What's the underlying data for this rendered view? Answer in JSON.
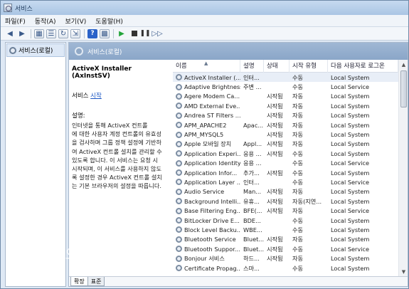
{
  "window": {
    "title": "서비스"
  },
  "menu": [
    "파일(F)",
    "동작(A)",
    "보기(V)",
    "도움말(H)"
  ],
  "toolbar": {
    "icons": [
      "back-icon",
      "forward-icon",
      "console-tree-icon",
      "list-icon",
      "refresh-icon",
      "export-icon",
      "help-icon",
      "properties-icon",
      "start-icon",
      "stop-icon",
      "pause-icon",
      "restart-icon"
    ]
  },
  "tree": {
    "root_label": "서비스(로컬)"
  },
  "header": {
    "title": "서비스(로컬)"
  },
  "details": {
    "service_name": "ActiveX Installer (AxInstSV)",
    "action_prefix": "서비스 ",
    "action_link": "시작",
    "desc_label": "설명:",
    "desc_lines": [
      "인터넷을 통해 ActiveX 컨트롤",
      "에 대한 사용자 계정 컨트롤의 유효성",
      "을 검사하며 그룹 정책 설정에 기반하",
      "여 ActiveX 컨트롤 설치를 관리할 수",
      "있도록 합니다. 이 서비스는 요청 시",
      "시작되며, 이 서비스를 사용하지 않도",
      "록 설정한 경우 ActiveX 컨트롤 설치",
      "는 기본 브라우저의 설정을 따릅니다."
    ]
  },
  "columns": {
    "name": "이름",
    "desc": "설명",
    "status": "상태",
    "startup": "시작 유형",
    "logon": "다음 사용자로 로그온"
  },
  "services": [
    {
      "name": "ActiveX Installer (...",
      "desc": "인터...",
      "status": "",
      "startup": "수동",
      "logon": "Local System"
    },
    {
      "name": "Adaptive Brightness",
      "desc": "주변 ...",
      "status": "",
      "startup": "수동",
      "logon": "Local Service"
    },
    {
      "name": "Agere Modem Ca...",
      "desc": "",
      "status": "시작됨",
      "startup": "자동",
      "logon": "Local System"
    },
    {
      "name": "AMD External Eve...",
      "desc": "",
      "status": "시작됨",
      "startup": "자동",
      "logon": "Local System"
    },
    {
      "name": "Andrea ST Filters ...",
      "desc": "",
      "status": "시작됨",
      "startup": "자동",
      "logon": "Local System"
    },
    {
      "name": "APM_APACHE2",
      "desc": "Apac...",
      "status": "시작됨",
      "startup": "자동",
      "logon": "Local System"
    },
    {
      "name": "APM_MYSQL5",
      "desc": "",
      "status": "시작됨",
      "startup": "자동",
      "logon": "Local System"
    },
    {
      "name": "Apple 모바일 장치",
      "desc": "Appl...",
      "status": "시작됨",
      "startup": "자동",
      "logon": "Local System"
    },
    {
      "name": "Application Experi...",
      "desc": "응용 ...",
      "status": "시작됨",
      "startup": "수동",
      "logon": "Local System"
    },
    {
      "name": "Application Identity",
      "desc": "응용 ...",
      "status": "",
      "startup": "수동",
      "logon": "Local Service"
    },
    {
      "name": "Application Infor...",
      "desc": "추가...",
      "status": "시작됨",
      "startup": "수동",
      "logon": "Local System"
    },
    {
      "name": "Application Layer ...",
      "desc": "인터...",
      "status": "",
      "startup": "수동",
      "logon": "Local Service"
    },
    {
      "name": "Audio Service",
      "desc": "Man...",
      "status": "시작됨",
      "startup": "자동",
      "logon": "Local System"
    },
    {
      "name": "Background Intelli...",
      "desc": "유휴...",
      "status": "시작됨",
      "startup": "자동(지연...",
      "logon": "Local System"
    },
    {
      "name": "Base Filtering Eng...",
      "desc": "BFE(...",
      "status": "시작됨",
      "startup": "자동",
      "logon": "Local Service"
    },
    {
      "name": "BitLocker Drive E...",
      "desc": "BDE...",
      "status": "",
      "startup": "수동",
      "logon": "Local System"
    },
    {
      "name": "Block Level Backu...",
      "desc": "WBE...",
      "status": "",
      "startup": "수동",
      "logon": "Local System"
    },
    {
      "name": "Bluetooth Service",
      "desc": "Bluet...",
      "status": "시작됨",
      "startup": "자동",
      "logon": "Local System"
    },
    {
      "name": "Bluetooth Suppor...",
      "desc": "Bluet...",
      "status": "시작됨",
      "startup": "수동",
      "logon": "Local Service"
    },
    {
      "name": "Bonjour 서비스",
      "desc": "하드...",
      "status": "시작됨",
      "startup": "자동",
      "logon": "Local System"
    },
    {
      "name": "Certificate Propag...",
      "desc": "스마...",
      "status": "",
      "startup": "수동",
      "logon": "Local System"
    }
  ],
  "tabs": [
    "확장",
    "표준"
  ],
  "watermark": "마술의 티스토리"
}
